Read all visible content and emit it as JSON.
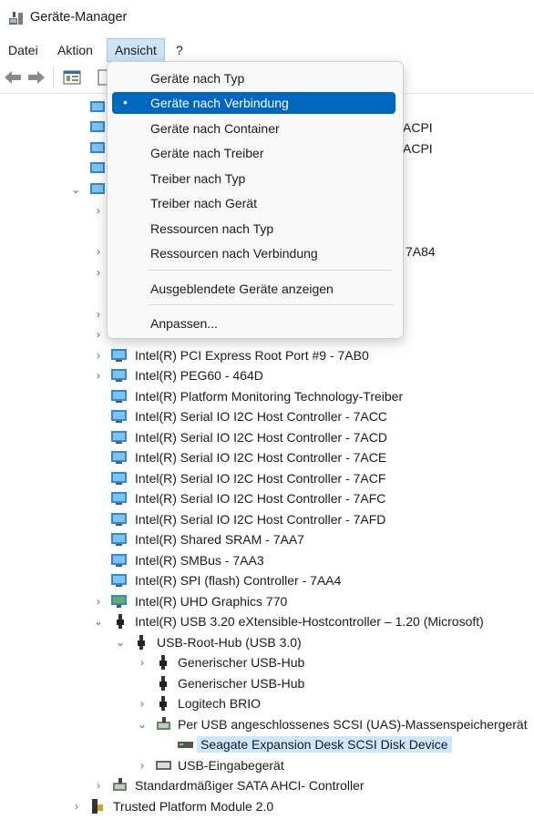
{
  "window": {
    "title": "Geräte-Manager",
    "app_icon": "device-manager-icon"
  },
  "menubar": {
    "items": [
      "Datei",
      "Aktion",
      "Ansicht",
      "?"
    ]
  },
  "toolbar": {
    "buttons": [
      "back-arrow-icon",
      "forward-arrow-icon",
      "properties-icon",
      "driver-icon"
    ]
  },
  "dropdown": {
    "items": [
      "Geräte nach Typ",
      "Geräte nach Verbindung",
      "Geräte nach Container",
      "Geräte nach Treiber",
      "Treiber nach Typ",
      "Treiber nach Gerät",
      "Ressourcen nach Typ",
      "Ressourcen nach Verbindung"
    ],
    "selected_bullet": "•",
    "extra": [
      "Ausgeblendete Geräte anzeigen",
      "Anpassen..."
    ]
  },
  "tree": {
    "partial_right": [
      "ACPI",
      "ACPI",
      "7A84"
    ],
    "rows": [
      "Intel(R) PCI Express Root Port #9 - 7AB0",
      "Intel(R) PEG60 - 464D",
      "Intel(R) Platform Monitoring Technology-Treiber",
      "Intel(R) Serial IO I2C Host Controller - 7ACC",
      "Intel(R) Serial IO I2C Host Controller - 7ACD",
      "Intel(R) Serial IO I2C Host Controller - 7ACE",
      "Intel(R) Serial IO I2C Host Controller - 7ACF",
      "Intel(R) Serial IO I2C Host Controller - 7AFC",
      "Intel(R) Serial IO I2C Host Controller - 7AFD",
      "Intel(R) Shared SRAM - 7AA7",
      "Intel(R) SMBus - 7AA3",
      "Intel(R) SPI (flash) Controller - 7AA4",
      "Intel(R) UHD Graphics 770",
      "Intel(R) USB 3.20 eXtensible-Hostcontroller – 1.20 (Microsoft)",
      "USB-Root-Hub (USB 3.0)",
      "Generischer USB-Hub",
      "Generischer USB-Hub",
      "Logitech BRIO",
      "Per USB angeschlossenes SCSI (UAS)-Massenspeichergerät",
      "Seagate Expansion Desk SCSI Disk Device",
      "USB-Eingabegerät",
      "Standardmäßiger SATA AHCI- Controller",
      "Trusted Platform Module 2.0"
    ]
  },
  "colors": {
    "accent": "#0067c0",
    "selection": "#cce8ff",
    "menu_active": "#cce4f7"
  }
}
